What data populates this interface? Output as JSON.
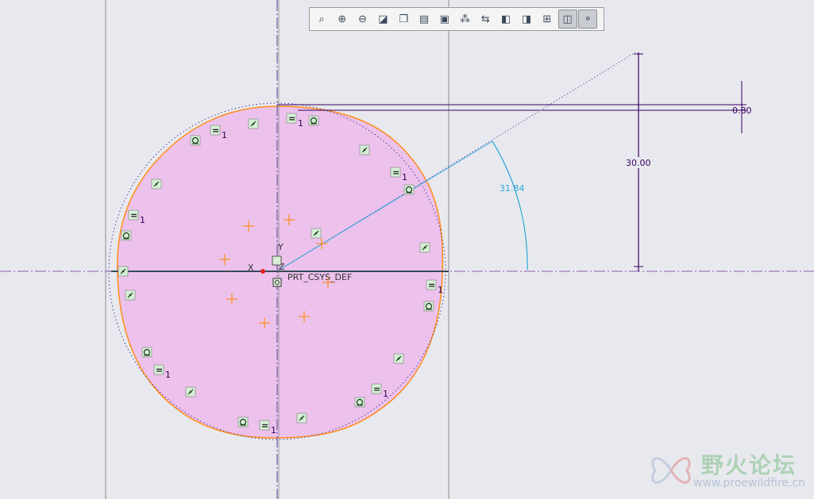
{
  "toolbar": {
    "buttons": [
      {
        "name": "zoom-fit-icon",
        "glyph": "⌕"
      },
      {
        "name": "zoom-in-icon",
        "glyph": "⊕"
      },
      {
        "name": "zoom-out-icon",
        "glyph": "⊖"
      },
      {
        "name": "repaint-icon",
        "glyph": "◪"
      },
      {
        "name": "display-style-icon",
        "glyph": "❐"
      },
      {
        "name": "saved-views-icon",
        "glyph": "▤"
      },
      {
        "name": "view-manager-icon",
        "glyph": "▣"
      },
      {
        "name": "datum-display-icon",
        "glyph": "⁂"
      },
      {
        "name": "spin-center-icon",
        "glyph": "⇆"
      },
      {
        "name": "shading-icon",
        "glyph": "◧"
      },
      {
        "name": "hidden-line-icon",
        "glyph": "◨"
      },
      {
        "name": "dimension-display-icon",
        "glyph": "⊞"
      },
      {
        "name": "constraint-display-icon",
        "glyph": "◫"
      },
      {
        "name": "vertex-display-icon",
        "glyph": "⚬"
      }
    ],
    "active": [
      12,
      13
    ]
  },
  "sketch": {
    "csys_label": "PRT_CSYS_DEF",
    "axis_x": "X",
    "axis_y": "Y",
    "axis_z": "Z",
    "dim_angle": "31.84",
    "dim_height": "30.00",
    "dim_offset": "0.80",
    "equal_symbol": "=",
    "equal_index": "1",
    "fill_color": "#ecc2ec",
    "curve_color": "#ff8c1a",
    "dim_color": "#3a0060",
    "angle_color": "#2aa6d8"
  },
  "watermark": {
    "title": "野火论坛",
    "url": "www.proewildfire.cn"
  }
}
